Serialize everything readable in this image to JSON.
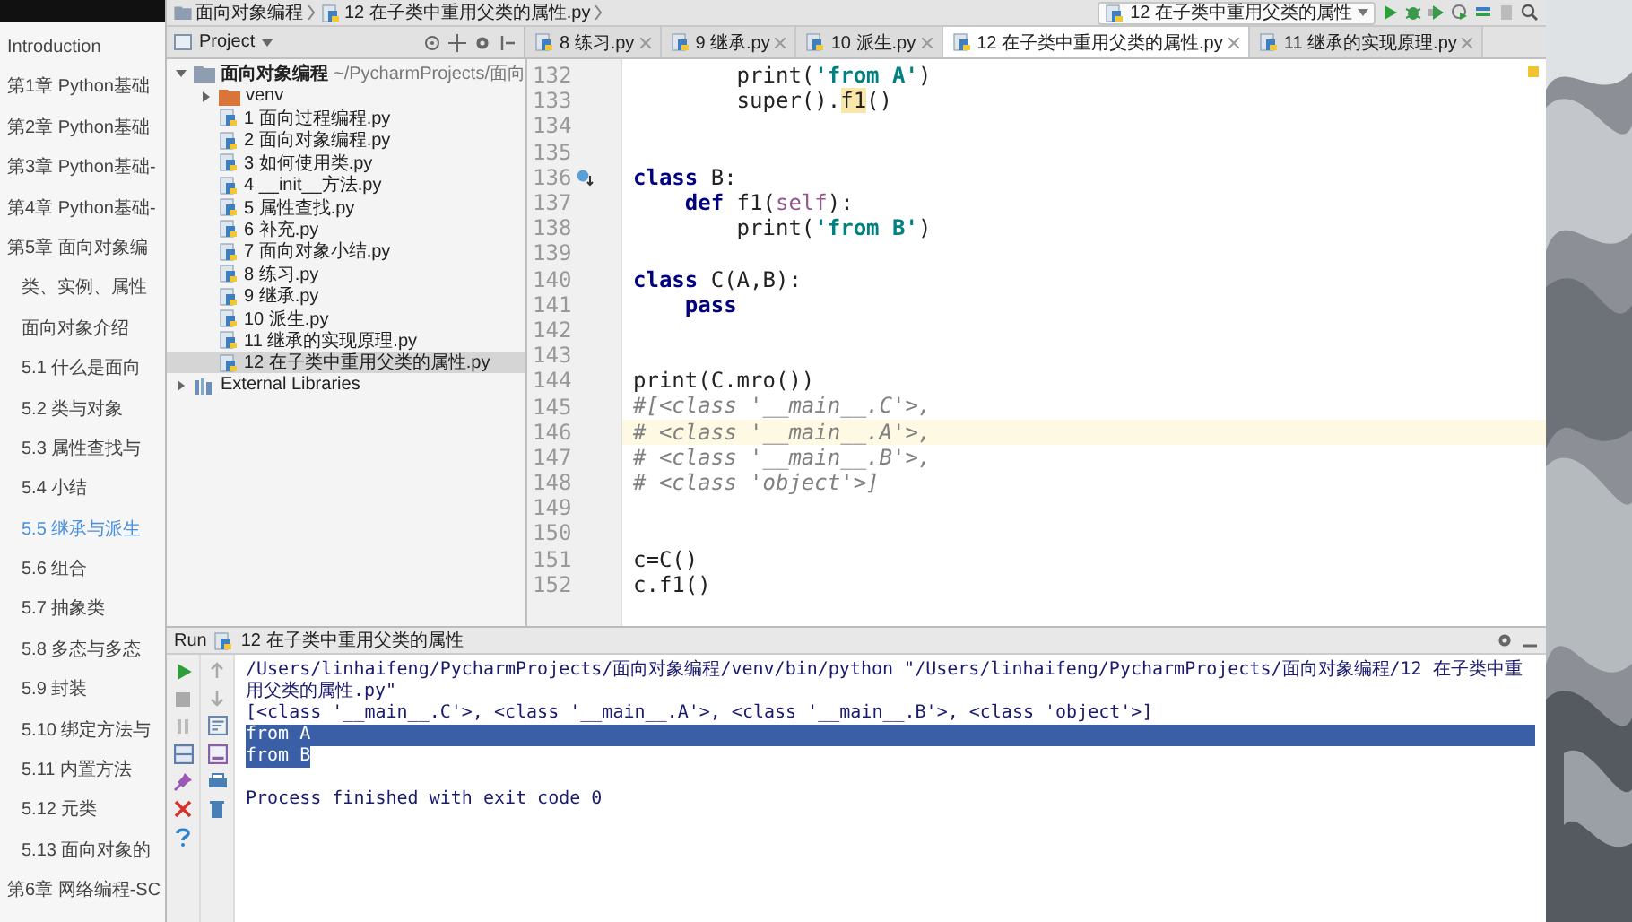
{
  "sidebar": {
    "items": [
      {
        "label": "Introduction",
        "selected": false
      },
      {
        "label": "第1章 Python基础",
        "selected": false
      },
      {
        "label": "第2章 Python基础",
        "selected": false
      },
      {
        "label": "第3章 Python基础-",
        "selected": false
      },
      {
        "label": "第4章 Python基础-",
        "selected": false
      },
      {
        "label": "第5章 面向对象编",
        "selected": false,
        "children": [
          {
            "label": "类、实例、属性",
            "selected": false
          },
          {
            "label": "面向对象介绍",
            "selected": false
          },
          {
            "label": "5.1 什么是面向",
            "selected": false
          },
          {
            "label": "5.2 类与对象",
            "selected": false
          },
          {
            "label": "5.3 属性查找与",
            "selected": false
          },
          {
            "label": "5.4 小结",
            "selected": false
          },
          {
            "label": "5.5 继承与派生",
            "selected": true
          },
          {
            "label": "5.6 组合",
            "selected": false
          },
          {
            "label": "5.7 抽象类",
            "selected": false
          },
          {
            "label": "5.8 多态与多态",
            "selected": false
          },
          {
            "label": "5.9 封装",
            "selected": false
          },
          {
            "label": "5.10 绑定方法与",
            "selected": false
          },
          {
            "label": "5.11 内置方法",
            "selected": false
          },
          {
            "label": "5.12 元类",
            "selected": false
          },
          {
            "label": "5.13 面向对象的",
            "selected": false
          }
        ]
      },
      {
        "label": "第6章 网络编程-SC",
        "selected": false
      }
    ]
  },
  "breadcrumb": [
    "面向对象编程",
    "12 在子类中重用父类的属性.py"
  ],
  "run_config": {
    "label": "12 在子类中重用父类的属性"
  },
  "project_panel": {
    "title": "Project",
    "tree": [
      {
        "label": "面向对象编程",
        "path": "~/PycharmProjects/面向",
        "kind": "folder",
        "expanded": true,
        "selected": false,
        "children": [
          {
            "label": "venv",
            "kind": "excluded_folder",
            "expanded": false,
            "selected": false
          },
          {
            "label": "1 面向过程编程.py",
            "kind": "file",
            "selected": false
          },
          {
            "label": "2 面向对象编程.py",
            "kind": "file",
            "selected": false
          },
          {
            "label": "3 如何使用类.py",
            "kind": "file",
            "selected": false
          },
          {
            "label": "4 __init__方法.py",
            "kind": "file",
            "selected": false
          },
          {
            "label": "5 属性查找.py",
            "kind": "file",
            "selected": false
          },
          {
            "label": "6 补充.py",
            "kind": "file",
            "selected": false
          },
          {
            "label": "7 面向对象小结.py",
            "kind": "file",
            "selected": false
          },
          {
            "label": "8 练习.py",
            "kind": "file",
            "selected": false
          },
          {
            "label": "9 继承.py",
            "kind": "file",
            "selected": false
          },
          {
            "label": "10 派生.py",
            "kind": "file",
            "selected": false
          },
          {
            "label": "11 继承的实现原理.py",
            "kind": "file",
            "selected": false
          },
          {
            "label": "12 在子类中重用父类的属性.py",
            "kind": "file",
            "selected": true
          }
        ]
      },
      {
        "label": "External Libraries",
        "kind": "library",
        "expanded": false,
        "selected": false
      }
    ]
  },
  "tabs": [
    {
      "label": "8 练习.py",
      "selected": false
    },
    {
      "label": "9 继承.py",
      "selected": false
    },
    {
      "label": "10 派生.py",
      "selected": false
    },
    {
      "label": "12 在子类中重用父类的属性.py",
      "selected": true
    },
    {
      "label": "11 继承的实现原理.py",
      "selected": false
    }
  ],
  "editor": {
    "lines": [
      {
        "number": "132",
        "current": false,
        "tokens": [
          {
            "kind": "plain",
            "t": "        print("
          },
          {
            "kind": "str",
            "t": "'from A'"
          },
          {
            "kind": "plain",
            "t": ")"
          }
        ]
      },
      {
        "number": "133",
        "current": false,
        "tokens": [
          {
            "kind": "plain",
            "t": "        super()."
          },
          {
            "kind": "hl",
            "t": "f1"
          },
          {
            "kind": "plain",
            "t": "()"
          }
        ]
      },
      {
        "number": "134",
        "current": false
      },
      {
        "number": "135",
        "current": false
      },
      {
        "number": "136",
        "current": false,
        "override": true,
        "tokens": [
          {
            "kind": "kw",
            "t": "class"
          },
          {
            "kind": "plain",
            "t": " B:"
          }
        ]
      },
      {
        "number": "137",
        "current": false,
        "tokens": [
          {
            "kind": "kw",
            "t": "    def"
          },
          {
            "kind": "plain",
            "t": " f1("
          },
          {
            "kind": "self",
            "t": "self"
          },
          {
            "kind": "plain",
            "t": "):"
          }
        ]
      },
      {
        "number": "138",
        "current": false,
        "tokens": [
          {
            "kind": "plain",
            "t": "        print("
          },
          {
            "kind": "str",
            "t": "'from B'"
          },
          {
            "kind": "plain",
            "t": ")"
          }
        ]
      },
      {
        "number": "139",
        "current": false
      },
      {
        "number": "140",
        "current": false,
        "tokens": [
          {
            "kind": "kw",
            "t": "class"
          },
          {
            "kind": "plain",
            "t": " C(A,B):"
          }
        ]
      },
      {
        "number": "141",
        "current": false,
        "tokens": [
          {
            "kind": "kw",
            "t": "    pass"
          }
        ]
      },
      {
        "number": "142",
        "current": false
      },
      {
        "number": "143",
        "current": false
      },
      {
        "number": "144",
        "current": false,
        "tokens": [
          {
            "kind": "plain",
            "t": "print(C.mro())"
          }
        ]
      },
      {
        "number": "145",
        "current": false,
        "tokens": [
          {
            "kind": "comment",
            "t": "#[<class '__main__.C'>,"
          }
        ]
      },
      {
        "number": "146",
        "current": true,
        "tokens": [
          {
            "kind": "comment",
            "t": "# <class '__main__.A'>,"
          }
        ]
      },
      {
        "number": "147",
        "current": false,
        "tokens": [
          {
            "kind": "comment",
            "t": "# <class '__main__.B'>,"
          }
        ]
      },
      {
        "number": "148",
        "current": false,
        "tokens": [
          {
            "kind": "comment",
            "t": "# <class 'object'>]"
          }
        ]
      },
      {
        "number": "149",
        "current": false
      },
      {
        "number": "150",
        "current": false
      },
      {
        "number": "151",
        "current": false,
        "tokens": [
          {
            "kind": "plain",
            "t": "c=C()"
          }
        ]
      },
      {
        "number": "152",
        "current": false,
        "tokens": [
          {
            "kind": "plain",
            "t": "c.f1()"
          }
        ]
      }
    ]
  },
  "run_panel": {
    "label": "Run",
    "title": "12 在子类中重用父类的属性",
    "output": [
      {
        "kind": "command",
        "selected": false,
        "text": "/Users/linhaifeng/PycharmProjects/面向对象编程/venv/bin/python \"/Users/linhaifeng/PycharmProjects/面向对象编程/12 在子类中重用父类的属性.py\""
      },
      {
        "kind": "stdout",
        "selected": false,
        "text": "[<class '__main__.C'>, <class '__main__.A'>, <class '__main__.B'>, <class 'object'>]"
      },
      {
        "kind": "stdout",
        "selected": true,
        "text": "from A"
      },
      {
        "kind": "stdout",
        "selected": true,
        "text": "from B"
      },
      {
        "kind": "exit",
        "selected": false,
        "text": "Process finished with exit code 0"
      }
    ]
  }
}
